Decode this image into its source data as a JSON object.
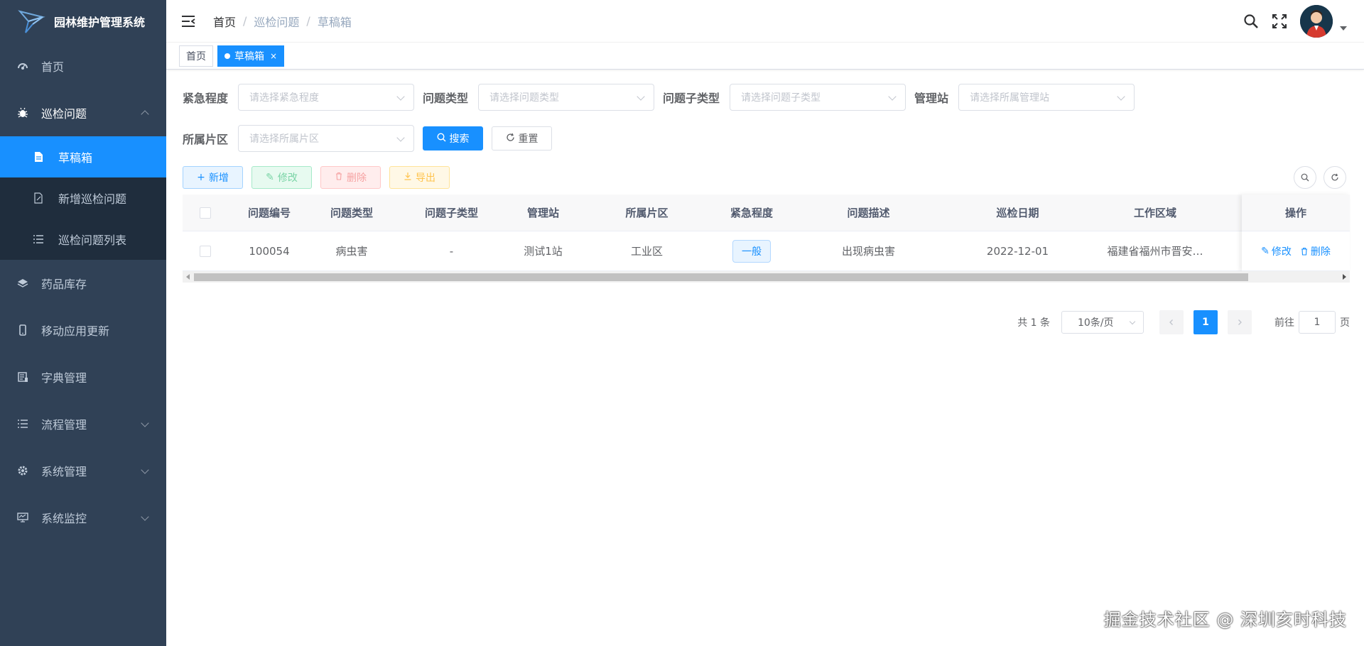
{
  "app": {
    "title": "园林维护管理系统"
  },
  "sidebar": {
    "items": [
      {
        "label": "首页"
      },
      {
        "label": "巡检问题"
      },
      {
        "label": "草稿箱"
      },
      {
        "label": "新增巡检问题"
      },
      {
        "label": "巡检问题列表"
      },
      {
        "label": "药品库存"
      },
      {
        "label": "移动应用更新"
      },
      {
        "label": "字典管理"
      },
      {
        "label": "流程管理"
      },
      {
        "label": "系统管理"
      },
      {
        "label": "系统监控"
      }
    ]
  },
  "breadcrumb": {
    "items": [
      "首页",
      "巡检问题",
      "草稿箱"
    ],
    "sep": "/"
  },
  "tags": {
    "home": "首页",
    "active": "草稿箱",
    "close": "×"
  },
  "filters": {
    "urgency": {
      "label": "紧急程度",
      "placeholder": "请选择紧急程度"
    },
    "type": {
      "label": "问题类型",
      "placeholder": "请选择问题类型"
    },
    "subtype": {
      "label": "问题子类型",
      "placeholder": "请选择问题子类型"
    },
    "station": {
      "label": "管理站",
      "placeholder": "请选择所属管理站"
    },
    "area": {
      "label": "所属片区",
      "placeholder": "请选择所属片区"
    },
    "search_label": "搜索",
    "reset_label": "重置"
  },
  "toolbar": {
    "add": "新增",
    "edit": "修改",
    "delete": "删除",
    "export": "导出"
  },
  "table": {
    "headers": [
      "问题编号",
      "问题类型",
      "问题子类型",
      "管理站",
      "所属片区",
      "紧急程度",
      "问题描述",
      "巡检日期",
      "工作区域",
      "操作"
    ],
    "rows": [
      {
        "id": "100054",
        "type": "病虫害",
        "subtype": "-",
        "station": "测试1站",
        "area": "工业区",
        "urgency": "一般",
        "desc": "出现病虫害",
        "date": "2022-12-01",
        "region": "福建省福州市晋安…",
        "edit": "修改",
        "delete": "删除"
      }
    ]
  },
  "pagination": {
    "total": "共 1 条",
    "page_size": "10条/页",
    "current": "1",
    "goto_prefix": "前往",
    "goto_value": "1",
    "goto_suffix": "页"
  },
  "watermark": "掘金技术社区 @ 深圳亥时科技",
  "colors": {
    "sidebar_bg": "#304156",
    "submenu_bg": "#1f2d3d",
    "primary": "#1890ff"
  }
}
